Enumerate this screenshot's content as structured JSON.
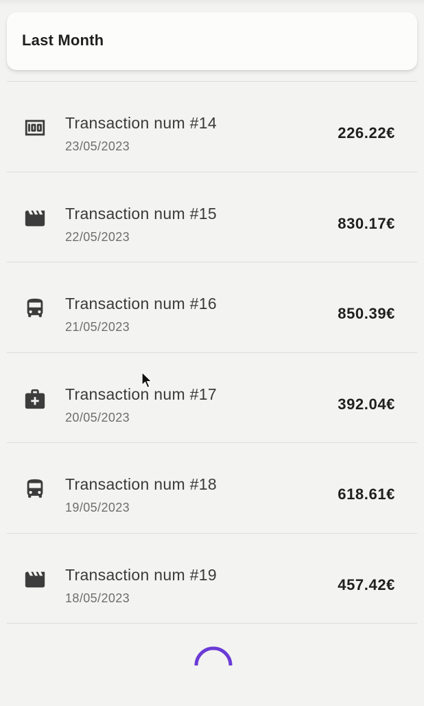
{
  "header": {
    "title": "Last Month"
  },
  "transactions": [
    {
      "title": "Transaction num #14",
      "date": "23/05/2023",
      "amount": "226.22€",
      "icon": "money-icon"
    },
    {
      "title": "Transaction num #15",
      "date": "22/05/2023",
      "amount": "830.17€",
      "icon": "movie-icon"
    },
    {
      "title": "Transaction num #16",
      "date": "21/05/2023",
      "amount": "850.39€",
      "icon": "bus-icon"
    },
    {
      "title": "Transaction num #17",
      "date": "20/05/2023",
      "amount": "392.04€",
      "icon": "medical-bag-icon"
    },
    {
      "title": "Transaction num #18",
      "date": "19/05/2023",
      "amount": "618.61€",
      "icon": "bus-icon"
    },
    {
      "title": "Transaction num #19",
      "date": "18/05/2023",
      "amount": "457.42€",
      "icon": "movie-icon"
    }
  ],
  "loader": {
    "icon": "loading-spinner-icon",
    "color": "#6a3bd6"
  },
  "colors": {
    "background": "#f3f3f1",
    "card": "#fcfcfa",
    "icon": "#3c3c3c",
    "divider": "#dcdcda"
  }
}
